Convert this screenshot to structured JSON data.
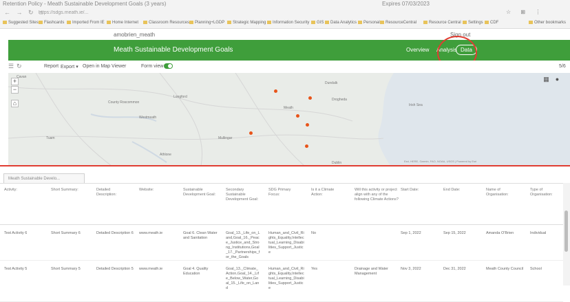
{
  "browser": {
    "tab_title": "Retention Policy - Meath Sustainable Development Goals (3 years)",
    "expires": "Expires 07/03/2023",
    "url": "https://sdgs.meath.ie/...",
    "nav_glyphs": "← → ↻ ⌂",
    "browser_icon_glyphs": "☆ ⊞ ⋮",
    "bookmarks": [
      "Suggested Sites",
      "Flashcards",
      "Imported From IE",
      "Home Internet",
      "Classroom Resources",
      "Planning+LGDP",
      "Strategic Mapping",
      "Information Security",
      "GIS",
      "Data Analytics",
      "Personal",
      "ResourceCentral",
      "Resource Central",
      "Settings",
      "CDF",
      "Other bookmarks"
    ]
  },
  "userbar": {
    "username": "amobrien_meath",
    "signout": "Sign out"
  },
  "header": {
    "title": "Meath Sustainable Development Goals",
    "nav": {
      "overview": "Overview",
      "analysis": "Analysis",
      "data": "Data"
    }
  },
  "toolbar": {
    "report": "Report",
    "export": "Export",
    "open_map_viewer": "Open in Map Viewer",
    "form_view": "Form view",
    "page_count": "5/6"
  },
  "map": {
    "labels": [
      "Cavan",
      "County Roscommon",
      "Longford",
      "Westmeath",
      "Meath",
      "Dundalk",
      "Drogheda",
      "Mullingar",
      "Tuam",
      "Athlone",
      "Dublin",
      "Irish Sea"
    ],
    "points": 6,
    "attribution": "Esri, HERE, Garmin, FAO, NOAA, USGS | Powered by Esri"
  },
  "panel": {
    "tab_label": "Meath Sustainable Develo..."
  },
  "table": {
    "columns": [
      "Activity:",
      "Short Summary:",
      "Detailed Description:",
      "Website:",
      "Sustainable Development Goal:",
      "Secondary Sustainable Development Goal:",
      "SDG Primary Focus:",
      "Is it a Climate Action:",
      "Will this activity or project align with any of the following Climate Actions?",
      "Start Date:",
      "End Date:",
      "Name of Organisation:",
      "Type of Organisation:"
    ],
    "rows": [
      [
        "Test Activity 6",
        "Short Summary 6",
        "Detailed Description 6",
        "www.meath.ie",
        "Goal 6. Clean Water and Sanitation",
        "Goal_13._Life_on_Land,Goal_16._Peace_Justice_and_Strong_Institutions,Goal_17._Partnerships_for_the_Goals",
        "Human_and_Civil_Rights_Equality,Intellectual_Learning_Disabilities_Support_Justice",
        "No",
        "",
        "Sep 1, 2022",
        "Sep 15, 2022",
        "Amanda O'Brien",
        "Individual"
      ],
      [
        "Test Activity 5",
        "Short Summary 5",
        "Detailed Description 5",
        "www.meath.ie",
        "Goal 4. Quality Education",
        "Goal_13._Climate_Action,Goal_14._Life_Below_Water,Goal_15._Life_on_Land",
        "Human_and_Civil_Rights_Equality,Intellectual_Learning_Disabilities_Support_Justice",
        "Yes",
        "Drainage and Water Management",
        "Nov 3, 2022",
        "Dec 31, 2022",
        "Meath County Council",
        "School"
      ]
    ]
  }
}
